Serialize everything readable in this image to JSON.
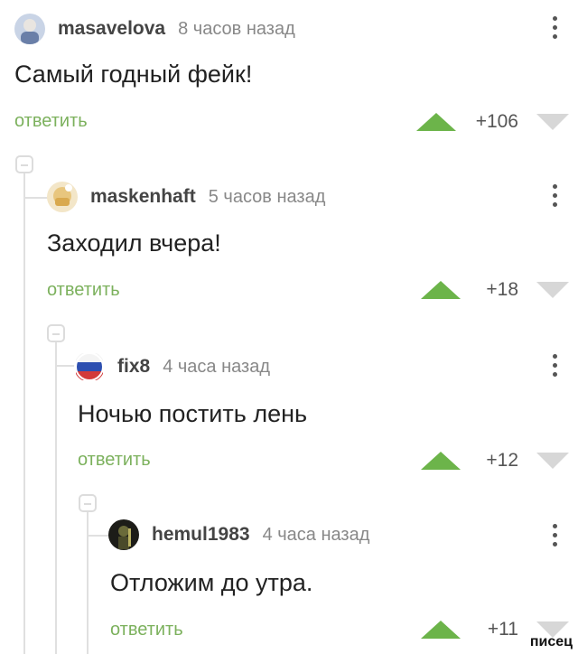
{
  "comments": [
    {
      "username": "masavelova",
      "time": "8 часов назад",
      "text": "Самый годный фейк!",
      "reply_label": "ответить",
      "score": "+106"
    },
    {
      "username": "maskenhaft",
      "time": "5 часов назад",
      "text": "Заходил вчера!",
      "reply_label": "ответить",
      "score": "+18"
    },
    {
      "username": "fix8",
      "time": "4 часа назад",
      "text": "Ночью постить лень",
      "reply_label": "ответить",
      "score": "+12"
    },
    {
      "username": "hemul1983",
      "time": "4 часа назад",
      "text": "Отложим до утра.",
      "reply_label": "ответить",
      "score": "+11"
    }
  ],
  "icons": {
    "upvote": "upvote-arrow-icon",
    "downvote": "downvote-arrow-icon",
    "more": "more-vertical-icon",
    "collapse": "collapse-thread-icon"
  },
  "colors": {
    "reply": "#7cb15d",
    "upvote": "#6cb44a",
    "downvote": "#d7d7d7"
  },
  "watermark": "писец"
}
